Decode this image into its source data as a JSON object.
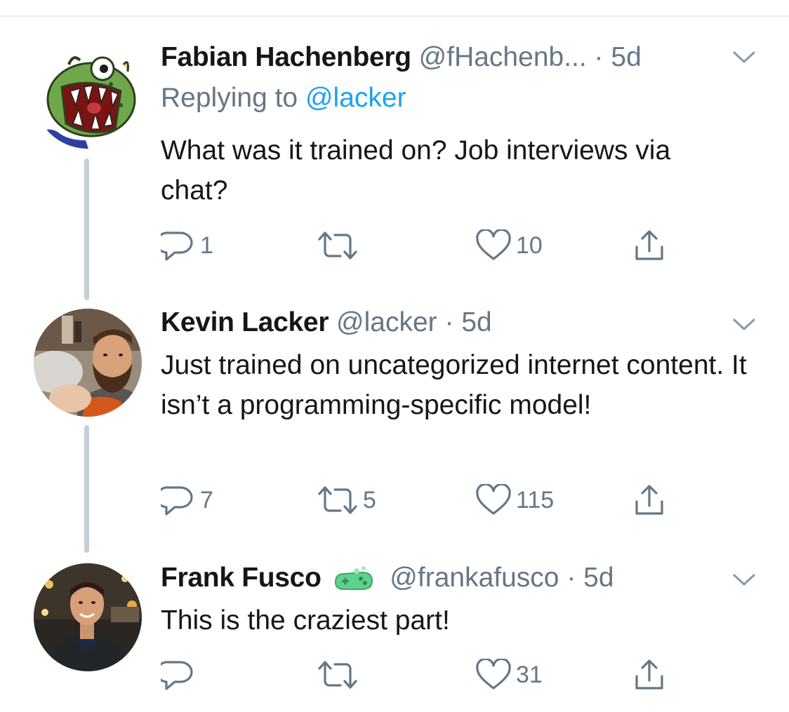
{
  "tweets": [
    {
      "name": "Fabian Hachenberg",
      "handle": "@fHachenb...",
      "dot": "·",
      "time": "5d",
      "replying_prefix": "Replying to",
      "replying_handle": "@lacker",
      "text": "What was it trained on? Job interviews via chat?",
      "counts": {
        "reply": "1",
        "retweet": "",
        "like": "10"
      },
      "avatar": "monster-avatar-icon"
    },
    {
      "name": "Kevin Lacker",
      "handle": "@lacker",
      "dot": "·",
      "time": "5d",
      "text": "Just trained on uncategorized internet content. It isn’t a programming-specific model!",
      "counts": {
        "reply": "7",
        "retweet": "5",
        "like": "115"
      },
      "avatar": "bearded-man-photo"
    },
    {
      "name": "Frank Fusco",
      "handle": "@frankafusco",
      "dot": "·",
      "time": "5d",
      "badge": "green-controller-emoji",
      "text": "This is the craziest part!",
      "counts": {
        "reply": "",
        "retweet": "",
        "like": "31"
      },
      "avatar": "man-night-street-photo"
    }
  ],
  "colors": {
    "text": "#14171a",
    "secondary": "#657786",
    "link": "#1da1f2",
    "thread_line": "#c4cfd6",
    "divider": "#e6ecf0"
  }
}
